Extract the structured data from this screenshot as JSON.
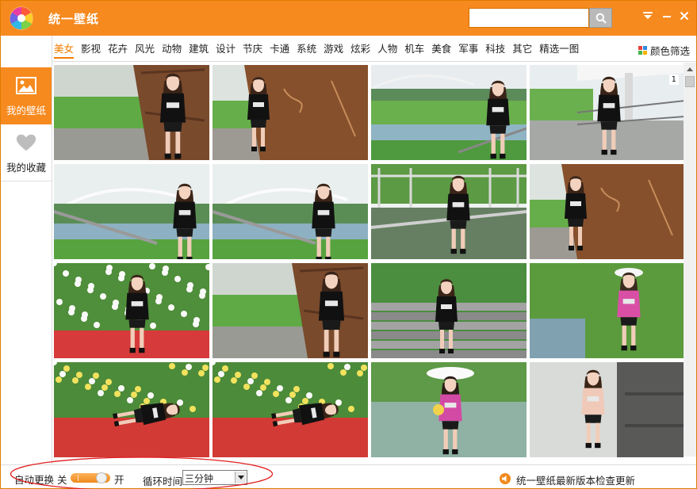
{
  "app": {
    "title": "统一壁纸",
    "brand_color": "#f68a1f",
    "search": {
      "value": "",
      "placeholder": ""
    }
  },
  "categories": [
    "美女",
    "影视",
    "花卉",
    "风光",
    "动物",
    "建筑",
    "设计",
    "节庆",
    "卡通",
    "系统",
    "游戏",
    "炫彩",
    "人物",
    "机车",
    "美食",
    "军事",
    "科技",
    "其它",
    "精选一图"
  ],
  "active_category": "美女",
  "color_filter_label": "颜色筛选",
  "sidebar": {
    "items": [
      {
        "label": "我的壁纸",
        "icon": "image-icon",
        "active": true
      },
      {
        "label": "我的收藏",
        "icon": "heart-icon",
        "active": false
      }
    ]
  },
  "thumbnails": [
    {
      "scene": "wall-left",
      "badge": ""
    },
    {
      "scene": "wall-right",
      "badge": ""
    },
    {
      "scene": "river",
      "badge": ""
    },
    {
      "scene": "walkway",
      "badge": "1"
    },
    {
      "scene": "bridge",
      "badge": ""
    },
    {
      "scene": "bridge2",
      "badge": ""
    },
    {
      "scene": "pergola",
      "badge": ""
    },
    {
      "scene": "wall-right2",
      "badge": ""
    },
    {
      "scene": "daisy",
      "badge": ""
    },
    {
      "scene": "wall-left2",
      "badge": ""
    },
    {
      "scene": "steps",
      "badge": ""
    },
    {
      "scene": "whitehat",
      "badge": ""
    },
    {
      "scene": "flowers-lying",
      "badge": ""
    },
    {
      "scene": "flowers-lying2",
      "badge": ""
    },
    {
      "scene": "hat-popsicle",
      "badge": ""
    },
    {
      "scene": "machine",
      "badge": ""
    }
  ],
  "bottom": {
    "auto_change_label": "自动更换",
    "off_label": "关",
    "on_label": "开",
    "toggle_state": "on",
    "cycle_label": "循环时间",
    "cycle_value": "三分钟",
    "update_text": "统一壁纸最新版本检查更新"
  }
}
